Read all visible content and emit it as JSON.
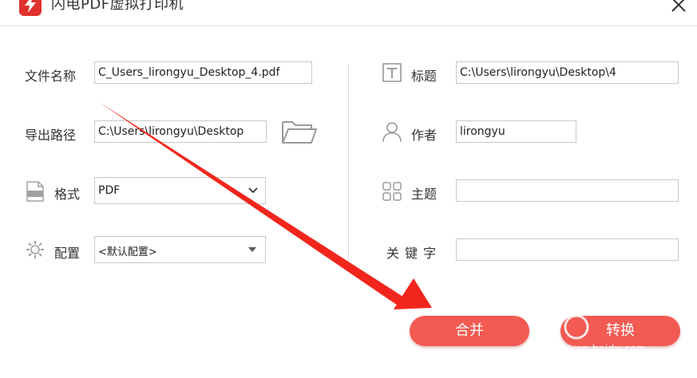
{
  "window": {
    "title": "闪电PDF虚拟打印机",
    "accent": "#e0312e",
    "button_color": "#f25a52"
  },
  "left": {
    "filename_label": "文件名称",
    "filename_value": "C_Users_lirongyu_Desktop_4.pdf",
    "path_label": "导出路径",
    "path_value": "C:\\Users\\lirongyu\\Desktop",
    "format_label": "格式",
    "format_value": "PDF",
    "config_label": "配置",
    "config_value": "<默认配置>"
  },
  "right": {
    "title_label": "标题",
    "title_value": "C:\\Users\\lirongyu\\Desktop\\4",
    "author_label": "作者",
    "author_value": "lirongyu",
    "subject_label": "主题",
    "subject_value": "",
    "keywords_label": "关 键 字",
    "keywords_value": ""
  },
  "buttons": {
    "merge": "合并",
    "convert": "转换"
  },
  "watermark": {
    "text": "jingyan.baidu.com"
  }
}
